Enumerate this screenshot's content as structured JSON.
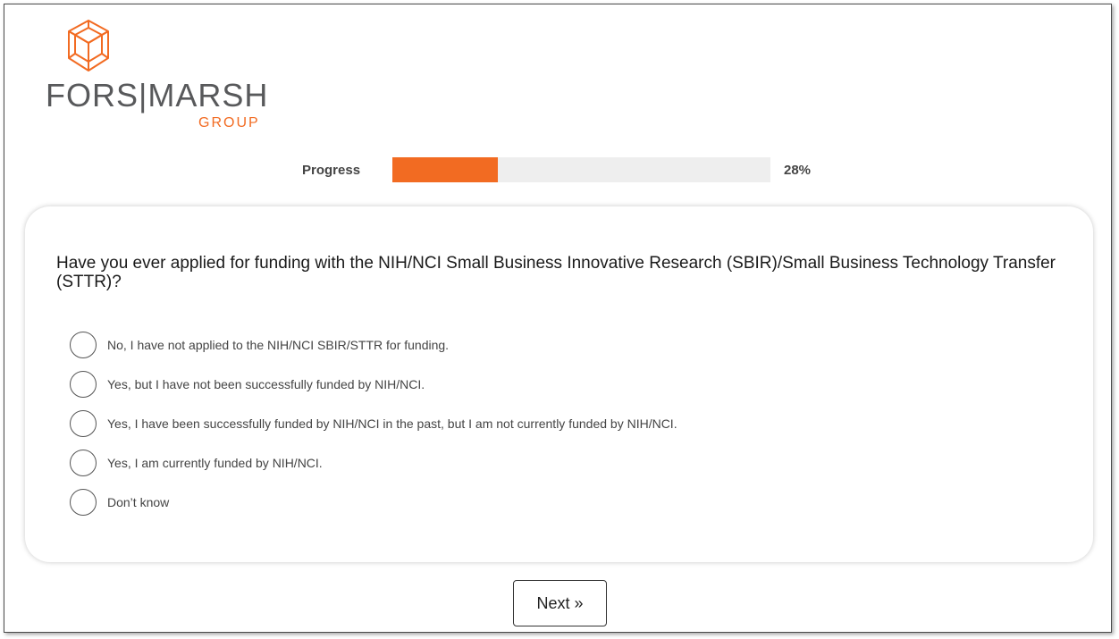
{
  "logo": {
    "wordmark": "FORS|MARSH",
    "subtext": "GROUP",
    "icon": "cube-lattice-icon",
    "brand_color": "#f26b22",
    "text_color": "#58595b"
  },
  "progress": {
    "label": "Progress",
    "percent": 28,
    "display": "28%",
    "fill_color": "#f26b22",
    "track_color": "#eeeeee"
  },
  "question": {
    "text": "Have you ever applied for funding with the NIH/NCI Small Business Innovative Research (SBIR)/Small Business Technology Transfer (STTR)?",
    "options": [
      {
        "label": "No, I have not applied to the NIH/NCI SBIR/STTR for funding.",
        "selected": false
      },
      {
        "label": "Yes, but I have not been successfully funded by NIH/NCI.",
        "selected": false
      },
      {
        "label": "Yes, I have been successfully funded by NIH/NCI in the past, but I am not currently funded by NIH/NCI.",
        "selected": false
      },
      {
        "label": "Yes, I am currently funded by NIH/NCI.",
        "selected": false
      },
      {
        "label": "Don’t know",
        "selected": false
      }
    ]
  },
  "navigation": {
    "next_label": "Next »"
  }
}
